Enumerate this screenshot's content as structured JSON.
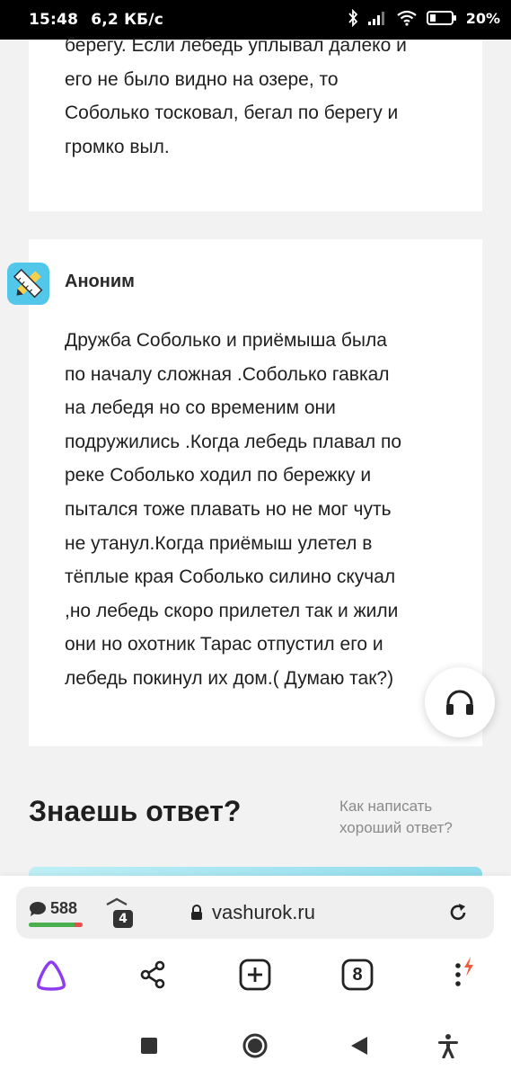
{
  "status_bar": {
    "time": "15:48",
    "net_speed": "6,2 КБ/с",
    "battery": "20%"
  },
  "prev_answer": {
    "lines": [
      "берегу. Если лебедь уплывал далеко и",
      "его не было видно на озере, то",
      "Соболько тосковал, бегал по берегу и",
      "громко выл."
    ]
  },
  "answer": {
    "author": "Аноним",
    "lines": [
      "Дружба Соболько и приёмыша была",
      "по началу сложная .Соболько гавкал",
      "на лебедя но со временим они",
      "подружились .Когда лебедь плавал по",
      "реке Соболько ходил по бережку и",
      "пытался тоже плавать но не мог чуть",
      "не утанул.Когда приёмыш улетел в",
      "тёплые края Соболько силино скучал",
      ",но лебедь скоро прилетел так и жили",
      "они но охотник Тарас отпустил его и",
      "лебедь покинул их дом.( Думаю так?)"
    ]
  },
  "know_answer": {
    "title": "Знаешь ответ?",
    "link_line1": "Как написать",
    "link_line2": "хороший ответ?"
  },
  "browser": {
    "comment_count": "588",
    "shield_badge": "4",
    "url": "vashurok.ru",
    "tabs_count": "8"
  },
  "icons": {
    "avatar": "pencil-ruler-icon",
    "headphones": "headphones-icon",
    "lock": "lock-icon",
    "reload": "reload-icon",
    "alice": "alice-assistant-icon",
    "share": "share-icon",
    "new_tab": "plus-square-icon",
    "menu": "kebab-menu-icon"
  },
  "colors": {
    "avatar_bg": "#53c7ea",
    "alice_purple": "#8e3cf0",
    "menu_bolt": "#f15a3a"
  }
}
